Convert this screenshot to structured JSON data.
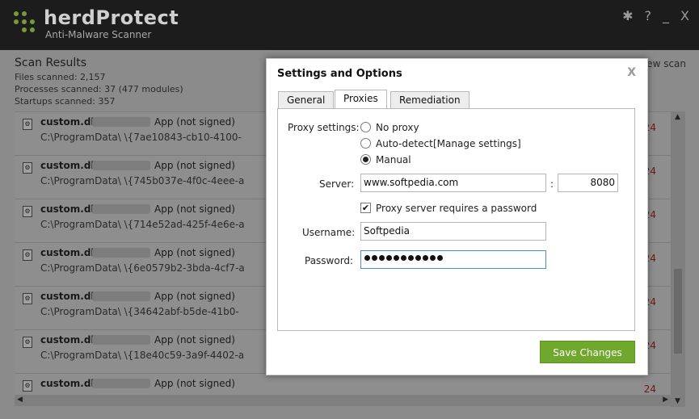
{
  "app": {
    "name": "herdProtect",
    "subtitle": "Anti-Malware Scanner",
    "controls": {
      "settings": "✱",
      "help": "?",
      "minimize": "_",
      "close": "X"
    },
    "brand_color": "#7a9a3a"
  },
  "scan": {
    "title": "Scan Results",
    "stats": [
      "Files scanned:  2,157",
      "Processes scanned:  37 (477 modules)",
      "Startups scanned:  357"
    ],
    "new_scan_label": "New scan"
  },
  "results": [
    {
      "name": "custom.dll",
      "app": "App (not signed)",
      "path": "C:\\ProgramData\\              \\{7ae10843-cb10-4100-",
      "num": "24"
    },
    {
      "name": "custom.dll",
      "app": "App (not signed)",
      "path": "C:\\ProgramData\\              \\{745b037e-4f0c-4eee-a",
      "num": "24"
    },
    {
      "name": "custom.dll",
      "app": "App (not signed)",
      "path": "C:\\ProgramData\\              \\{714e52ad-425f-4e6e-a",
      "num": "24"
    },
    {
      "name": "custom.dll",
      "app": "App (not signed)",
      "path": "C:\\ProgramData\\              \\{6e0579b2-3bda-4cf7-a",
      "num": "24"
    },
    {
      "name": "custom.dll",
      "app": "App (not signed)",
      "path": "C:\\ProgramData\\              \\{34642abf-b5de-41b0-",
      "num": "24"
    },
    {
      "name": "custom.dll",
      "app": "App (not signed)",
      "path": "C:\\ProgramData\\              \\{18e40c59-3a9f-4402-a",
      "num": "24"
    },
    {
      "name": "custom.dll",
      "app": "App (not signed)",
      "path": "C:\\ProgramData\\              \\",
      "num": "24"
    }
  ],
  "dialog": {
    "title": "Settings and Options",
    "close": "X",
    "tabs": [
      "General",
      "Proxies",
      "Remediation"
    ],
    "active_tab": "Proxies",
    "proxy_settings_label": "Proxy settings:",
    "options": [
      "No proxy",
      "Auto-detect",
      "Manual"
    ],
    "selected_option": "Manual",
    "manage_settings": "[Manage settings]",
    "server_label": "Server:",
    "server_value": "www.softpedia.com",
    "port_separator": ":",
    "port_value": "8080",
    "requires_password_label": "Proxy server requires a password",
    "requires_password_checked": true,
    "username_label": "Username:",
    "username_value": "Softpedia",
    "password_label": "Password:",
    "password_length": 11,
    "save_label": "Save Changes",
    "save_color": "#6fa82c"
  }
}
